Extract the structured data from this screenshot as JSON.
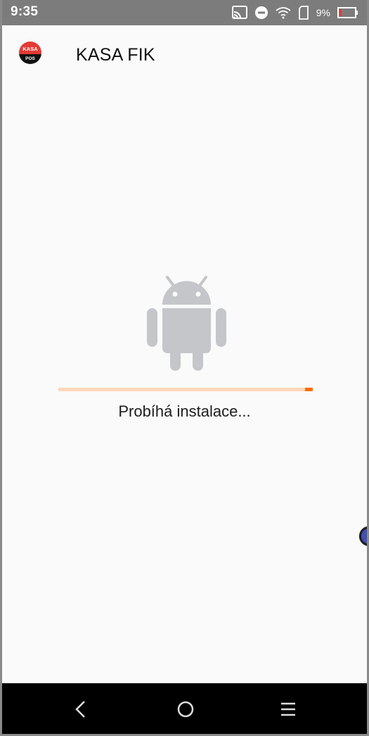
{
  "status_bar": {
    "time": "9:35",
    "battery_percent": "9%",
    "icons": [
      "cast-icon",
      "do-not-disturb-icon",
      "wifi-icon",
      "sim-icon",
      "battery-icon"
    ]
  },
  "app": {
    "title": "KASA FIK",
    "logo_text_top": "KASA",
    "logo_text_bottom": "POS"
  },
  "install": {
    "status": "Probíhá instalace...",
    "icon": "android-icon",
    "progress_fraction": 0.03
  },
  "nav": {
    "icons": [
      "back-icon",
      "home-icon",
      "menu-icon"
    ]
  },
  "colors": {
    "accent": "#ff6d00",
    "progress_track": "#ffd6b8",
    "android_gray": "#c4c6c9",
    "status_bar_bg": "#7c7c7c",
    "logo_red": "#e53935"
  }
}
